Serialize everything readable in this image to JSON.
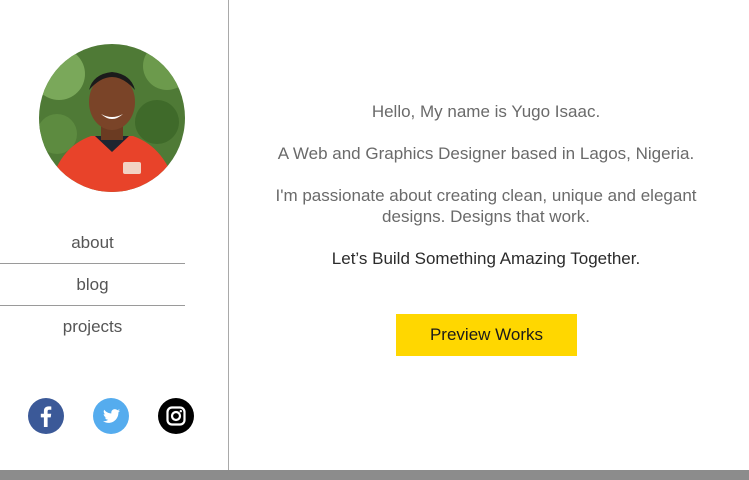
{
  "profile": {
    "avatar_icon": "profile-photo"
  },
  "nav": {
    "items": [
      {
        "label": "about"
      },
      {
        "label": "blog"
      },
      {
        "label": "projects"
      }
    ]
  },
  "social": {
    "icons": [
      "facebook-icon",
      "twitter-icon",
      "instagram-icon"
    ],
    "colors": {
      "facebook": "#3b5998",
      "twitter": "#55acee",
      "instagram": "#000000"
    }
  },
  "intro": {
    "greeting": "Hello, My name is Yugo Isaac.",
    "role": "A Web and Graphics Designer based in Lagos, Nigeria.",
    "passion": "I'm passionate about creating clean, unique and elegant designs. Designs that work.",
    "tagline": "Let’s Build Something Amazing Together."
  },
  "cta": {
    "label": "Preview Works",
    "color": "#ffd700"
  }
}
